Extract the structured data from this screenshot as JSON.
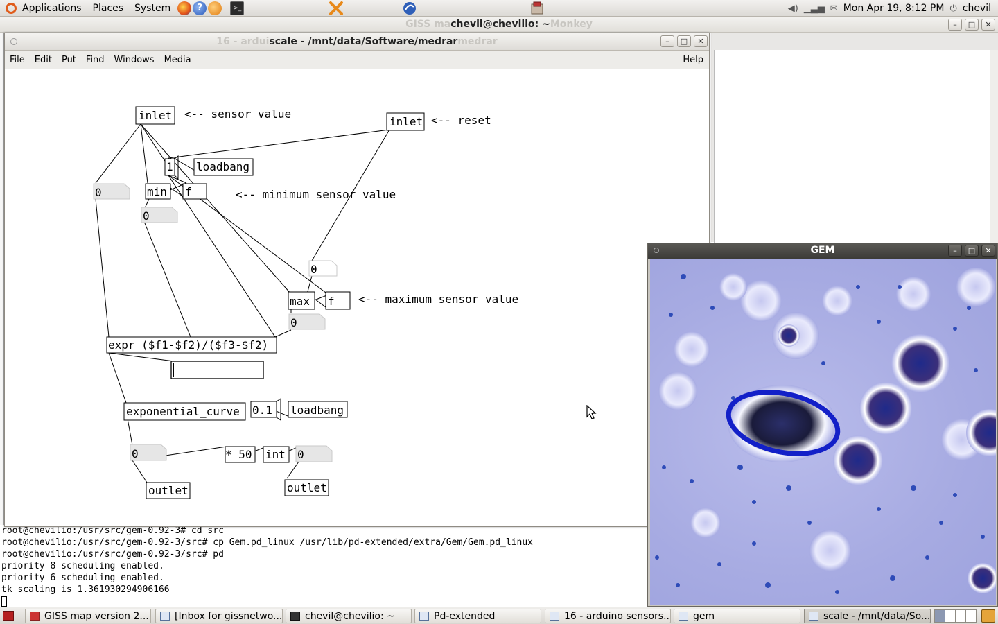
{
  "top_panel": {
    "menus": [
      "Applications",
      "Places",
      "System"
    ],
    "clock": "Mon Apr 19,  8:12 PM",
    "user": "chevil"
  },
  "terminal_window": {
    "title": "chevil@chevilio: ~",
    "ghost_title_left": "GISS ma",
    "ghost_title_right": "Monkey",
    "lines": [
      "root@chevilio:/usr/src/gem-0.92-3# cd src",
      "root@chevilio:/usr/src/gem-0.92-3/src# cp Gem.pd_linux /usr/lib/pd-extended/extra/Gem/Gem.pd_linux",
      "root@chevilio:/usr/src/gem-0.92-3/src# pd",
      "priority 8 scheduling enabled.",
      "priority 6 scheduling enabled.",
      "tk scaling is 1.361930294906166"
    ]
  },
  "pd_window": {
    "title": "scale  - /mnt/data/Software/medrar",
    "ghost_title_left": "16 - ardui",
    "ghost_title_right": "medrar",
    "menus": [
      "File",
      "Edit",
      "Put",
      "Find",
      "Windows",
      "Media"
    ],
    "help": "Help",
    "objects": {
      "inlet_sensor": "inlet",
      "inlet_reset": "inlet",
      "msg_one": "1",
      "loadbang_top": "loadbang",
      "num_left": "0",
      "min": "min",
      "f_min": "f",
      "num_min": "0",
      "num_max_top": "0",
      "max": "max",
      "f_max": "f",
      "num_max": "0",
      "expr": "expr ($f1-$f2)/($f3-$f2)",
      "exp_curve": "exponential_curve",
      "msg_tenth": "0.1",
      "loadbang_bottom": "loadbang",
      "num_out": "0",
      "mul": "* 50",
      "int": "int",
      "num_int": "0",
      "outlet_left": "outlet",
      "outlet_right": "outlet"
    },
    "comments": {
      "sensor": "<-- sensor value",
      "reset": "<-- reset",
      "min": "<-- minimum sensor value",
      "max": "<-- maximum sensor value"
    }
  },
  "gem_window": {
    "title": "GEM"
  },
  "taskbar": {
    "tasks": [
      "GISS map version 2....",
      "[Inbox for gissnetwo...",
      "chevil@chevilio: ~",
      "Pd-extended",
      "16 - arduino sensors...",
      "gem",
      "scale  - /mnt/data/So..."
    ]
  }
}
